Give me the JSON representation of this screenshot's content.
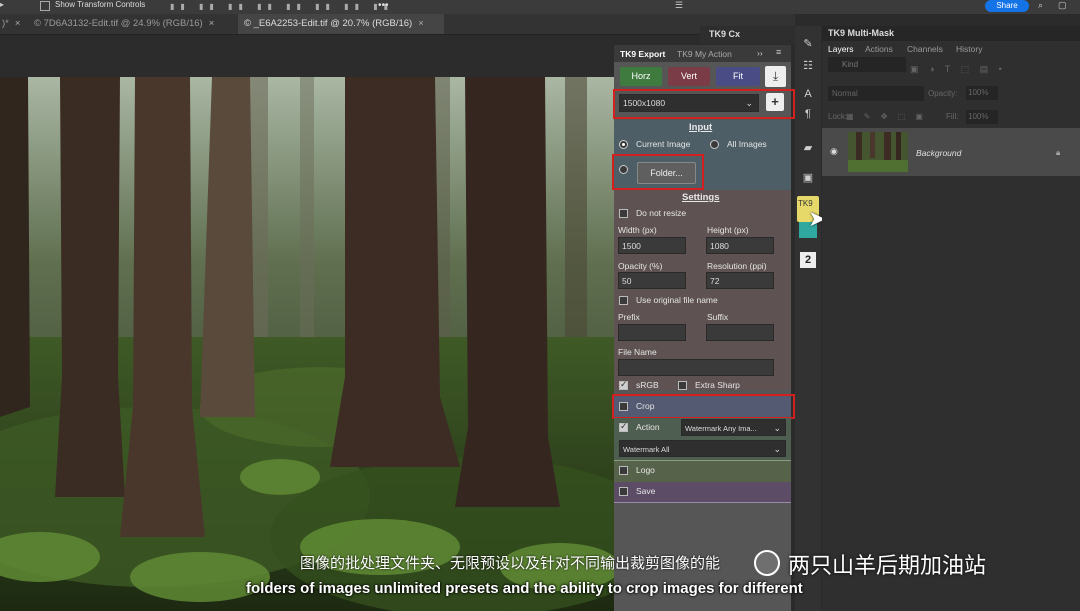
{
  "topbar": {
    "transform_label": "Show Transform Controls",
    "share_label": "Share"
  },
  "tabs": [
    {
      "label": "© 7D6A3132-Edit.tif @ 24.9% (RGB/16)",
      "close": "×"
    },
    {
      "label": "© _E6A2253-Edit.tif @ 20.7% (RGB/16)",
      "close": "×"
    }
  ],
  "tk9cx": {
    "title": "TK9 Cx"
  },
  "tk9panel": {
    "tab_export": "TK9 Export",
    "tab_myaction": "TK9 My Action",
    "more": "››",
    "btn_horz": "Horz",
    "btn_vert": "Vert",
    "btn_fit": "Fit",
    "preset_value": "1500x1080",
    "add": "+",
    "input_title": "Input",
    "radio_current": "Current Image",
    "radio_all": "All Images",
    "folder_btn": "Folder...",
    "settings_title": "Settings",
    "do_not_resize": "Do not resize",
    "width_label": "Width (px)",
    "width_value": "1500",
    "height_label": "Height (px)",
    "height_value": "1080",
    "opacity_label": "Opacity (%)",
    "opacity_value": "50",
    "resolution_label": "Resolution (ppi)",
    "resolution_value": "72",
    "use_original": "Use original file name",
    "prefix_label": "Prefix",
    "suffix_label": "Suffix",
    "filename_label": "File Name",
    "srgb": "sRGB",
    "extra_sharp": "Extra Sharp",
    "crop": "Crop",
    "action": "Action",
    "action_select": "Watermark Any Ima...",
    "action_set": "Watermark All",
    "logo": "Logo",
    "save": "Save"
  },
  "layers": {
    "panel_title": "TK9 Multi-Mask",
    "tabs": [
      "Layers",
      "Actions",
      "Channels",
      "History"
    ],
    "kind_placeholder": "Kind",
    "blend_mode": "Normal",
    "opacity_label": "Opacity:",
    "opacity_value": "100%",
    "lock_label": "Lock:",
    "fill_label": "Fill:",
    "fill_value": "100%",
    "layer_name": "Background"
  },
  "toolstrip": {
    "tk9_label": "TK9",
    "badge": "2"
  },
  "subtitles": {
    "cn": "图像的批处理文件夹、无限预设以及针对不同输出裁剪图像的能",
    "en": "folders of images unlimited presets and the ability to crop images for different",
    "watermark": "两只山羊后期加油站"
  },
  "colors": {
    "horz": "#3f7a3f",
    "vert": "#7a3c46",
    "fit": "#4a4c86",
    "highlight": "#d21f1f"
  }
}
